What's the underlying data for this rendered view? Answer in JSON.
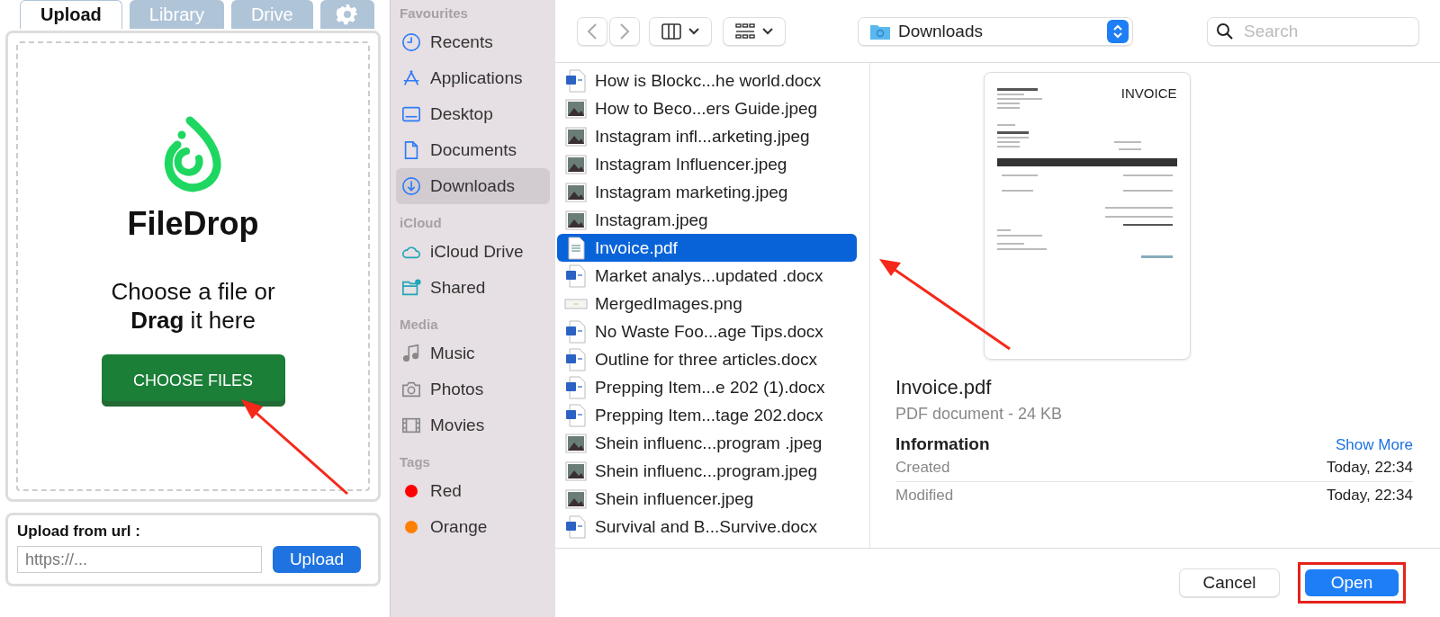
{
  "uploader": {
    "tabs": [
      {
        "kind": "text",
        "label": "Upload",
        "selected": true
      },
      {
        "kind": "text",
        "label": "Library",
        "selected": false
      },
      {
        "kind": "text",
        "label": "Drive",
        "selected": false
      },
      {
        "kind": "gear",
        "selected": false
      }
    ],
    "logo_name": "FileDrop",
    "prompt": "Choose a file or **Drag** it here",
    "choose_button": "CHOOSE FILES",
    "url_label": "Upload from url :",
    "url_placeholder": "https://...",
    "url_button": "Upload"
  },
  "sidebar": {
    "sections": [
      {
        "title": "Favourites",
        "items": [
          {
            "kind": "clock",
            "label": "Recents",
            "selected": false
          },
          {
            "kind": "apps",
            "label": "Applications",
            "selected": false
          },
          {
            "kind": "desktop",
            "label": "Desktop",
            "selected": false
          },
          {
            "kind": "document",
            "label": "Documents",
            "selected": false
          },
          {
            "kind": "download",
            "label": "Downloads",
            "selected": true
          }
        ]
      },
      {
        "title": "iCloud",
        "items": [
          {
            "kind": "cloud",
            "label": "iCloud Drive",
            "selected": false
          },
          {
            "kind": "shared",
            "label": "Shared",
            "selected": false
          }
        ]
      },
      {
        "title": "Media",
        "items": [
          {
            "kind": "music",
            "label": "Music",
            "selected": false
          },
          {
            "kind": "photo",
            "label": "Photos",
            "selected": false
          },
          {
            "kind": "movie",
            "label": "Movies",
            "selected": false
          }
        ]
      },
      {
        "title": "Tags",
        "items": [
          {
            "kind": "tag",
            "label": "Red",
            "color": "#ff0000",
            "selected": false
          },
          {
            "kind": "tag",
            "label": "Orange",
            "color": "#ff8000",
            "selected": false
          }
        ]
      }
    ]
  },
  "toolbar": {
    "location": "Downloads",
    "search_placeholder": "Search"
  },
  "files": [
    {
      "kind": "word",
      "name": "How is Blockc...he world.docx",
      "selected": false
    },
    {
      "kind": "image",
      "name": "How to Beco...ers Guide.jpeg",
      "selected": false
    },
    {
      "kind": "image",
      "name": "Instagram infl...arketing.jpeg",
      "selected": false
    },
    {
      "kind": "image",
      "name": "Instagram Influencer.jpeg",
      "selected": false
    },
    {
      "kind": "image",
      "name": "Instagram marketing.jpeg",
      "selected": false
    },
    {
      "kind": "image",
      "name": "Instagram.jpeg",
      "selected": false
    },
    {
      "kind": "pdf",
      "name": "Invoice.pdf",
      "selected": true
    },
    {
      "kind": "word",
      "name": "Market analys...updated .docx",
      "selected": false
    },
    {
      "kind": "png",
      "name": "MergedImages.png",
      "selected": false
    },
    {
      "kind": "word",
      "name": "No Waste Foo...age Tips.docx",
      "selected": false
    },
    {
      "kind": "word",
      "name": "Outline for three articles.docx",
      "selected": false
    },
    {
      "kind": "word",
      "name": "Prepping Item...e 202 (1).docx",
      "selected": false
    },
    {
      "kind": "word",
      "name": "Prepping Item...tage 202.docx",
      "selected": false
    },
    {
      "kind": "image",
      "name": "Shein influenc...program .jpeg",
      "selected": false
    },
    {
      "kind": "image",
      "name": "Shein influenc...program.jpeg",
      "selected": false
    },
    {
      "kind": "image",
      "name": "Shein influencer.jpeg",
      "selected": false
    },
    {
      "kind": "word",
      "name": "Survival and B...Survive.docx",
      "selected": false
    }
  ],
  "preview": {
    "doc_heading": "INVOICE",
    "name": "Invoice.pdf",
    "subtitle": "PDF document - 24 KB",
    "info_title": "Information",
    "show_more": "Show More",
    "rows": [
      {
        "label": "Created",
        "value": "Today, 22:34"
      },
      {
        "label": "Modified",
        "value": "Today, 22:34"
      }
    ]
  },
  "buttons": {
    "cancel": "Cancel",
    "open": "Open"
  }
}
